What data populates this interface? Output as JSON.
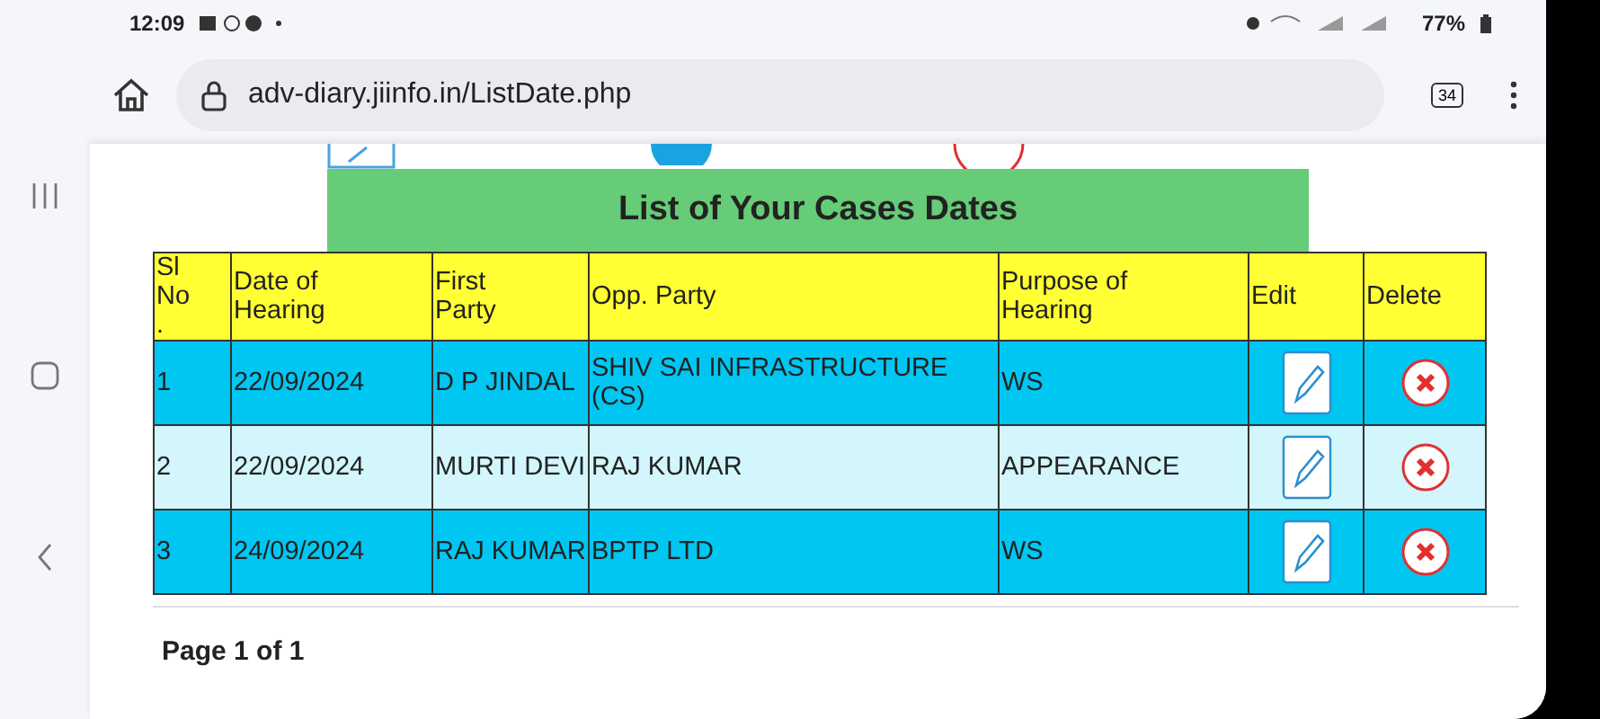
{
  "status_bar": {
    "time": "12:09",
    "battery": "77%"
  },
  "browser": {
    "url": "adv-diary.jiinfo.in/ListDate.php",
    "tab_count": "34"
  },
  "page": {
    "title": "List of Your Cases Dates",
    "table": {
      "columns": [
        "Sl No.",
        "Date of Hearing",
        "First Party",
        "Opp. Party",
        "Purpose of Hearing",
        "Edit",
        "Delete"
      ],
      "rows": [
        {
          "sl": "1",
          "date": "22/09/2024",
          "first_party": "D P JINDAL",
          "opp_party": "SHIV SAI INFRASTRUCTURE (CS)",
          "purpose": "WS"
        },
        {
          "sl": "2",
          "date": "22/09/2024",
          "first_party": "MURTI DEVI",
          "opp_party": "RAJ KUMAR",
          "purpose": "APPEARANCE"
        },
        {
          "sl": "3",
          "date": "24/09/2024",
          "first_party": "RAJ KUMAR",
          "opp_party": "BPTP LTD",
          "purpose": "WS"
        }
      ]
    },
    "pager": "Page 1 of 1"
  }
}
